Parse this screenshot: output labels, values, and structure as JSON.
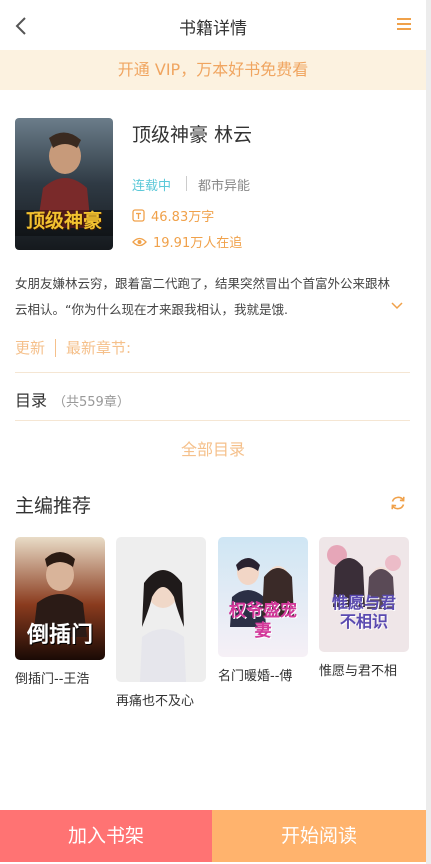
{
  "nav": {
    "title": "书籍详情",
    "back_icon": "chevron-left-icon",
    "menu_icon": "menu-icon"
  },
  "vip_banner": "开通 VIP，万本好书免费看",
  "book": {
    "title": "顶级神豪 林云",
    "cover_text": "顶级神豪",
    "status": "连载中",
    "genre": "都市异能",
    "words": "46.83万字",
    "readers": "19.91万人在追",
    "intro": "女朋友嫌林云穷，跟着富二代跑了，结果突然冒出个首富外公来跟林云相认。“你为什么现在才来跟我相认，我就是饿."
  },
  "update": {
    "label": "更新",
    "latest": "最新章节:"
  },
  "catalog": {
    "label": "目录",
    "count": "（共559章）",
    "all_label": "全部目录"
  },
  "recommend": {
    "title": "主编推荐",
    "items": [
      {
        "name": "倒插门--王浩",
        "cover_text": "倒插门"
      },
      {
        "name": "再痛也不及心",
        "cover_text": ""
      },
      {
        "name": "名门暖婚--傅",
        "cover_text": "权爷盛宠妻"
      },
      {
        "name": "惟愿与君不相",
        "cover_text": "惟愿与君不相识"
      }
    ]
  },
  "bottom": {
    "add_shelf": "加入书架",
    "start_read": "开始阅读"
  },
  "colors": {
    "accent": "#f0a14a",
    "status": "#5bc8d8",
    "add_button": "#ff7373",
    "read_button": "#ffb36d",
    "banner_bg": "#fcf2e0"
  }
}
